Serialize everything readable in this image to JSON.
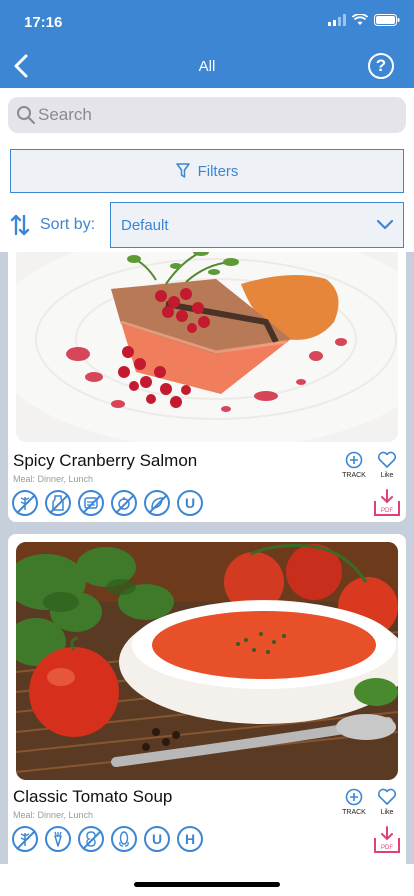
{
  "status": {
    "time": "17:16"
  },
  "nav": {
    "title": "All",
    "help_label": "?"
  },
  "search": {
    "placeholder": "Search",
    "value": ""
  },
  "filters": {
    "label": "Filters"
  },
  "sort": {
    "label": "Sort by:",
    "selected": "Default"
  },
  "recipes": [
    {
      "title": "Spicy Cranberry Salmon",
      "meal": "Meal: Dinner, Lunch",
      "diet_icons": [
        "no-gluten-icon",
        "no-dairy-icon",
        "no-grains-icon",
        "no-nuts-icon",
        "no-shellfish-icon",
        "u-icon"
      ],
      "diet_letters": {
        "u": "U"
      },
      "track_label": "TRACK",
      "like_label": "Like",
      "pdf_label": "PDF"
    },
    {
      "title": "Classic Tomato Soup",
      "meal": "Meal: Dinner, Lunch",
      "diet_icons": [
        "no-gluten-icon",
        "carrot-icon",
        "no-peanut-icon",
        "corn-icon",
        "u-icon",
        "h-icon"
      ],
      "diet_letters": {
        "u": "U",
        "h": "H"
      },
      "track_label": "TRACK",
      "like_label": "Like",
      "pdf_label": "PDF"
    }
  ],
  "colors": {
    "accent": "#3d86d3",
    "pdf": "#e0407a",
    "feed_bg": "#c7cedc"
  }
}
